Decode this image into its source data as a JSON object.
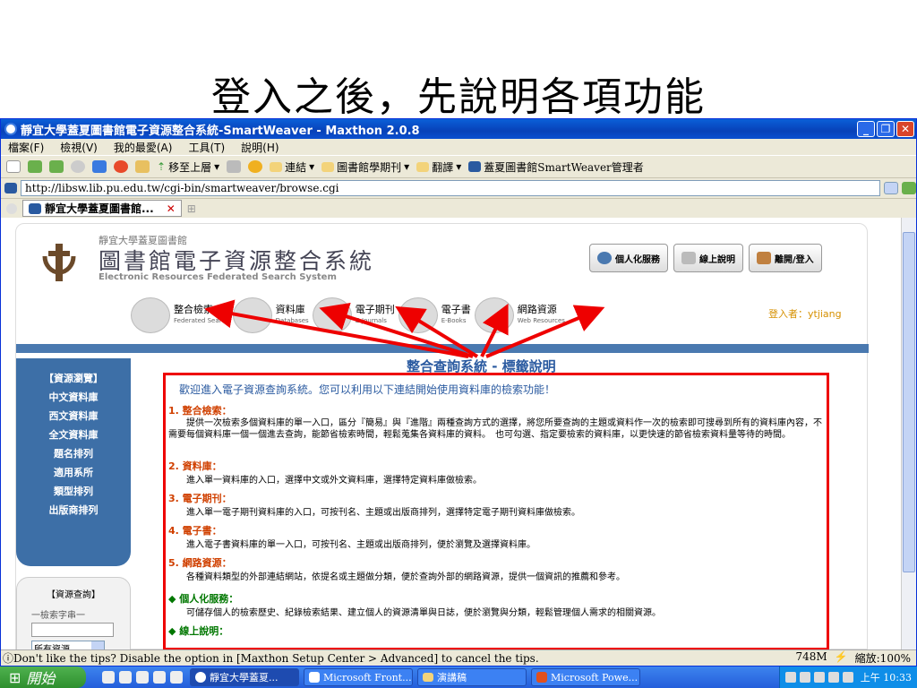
{
  "slide": {
    "title": "登入之後，先說明各項功能"
  },
  "window": {
    "title": "靜宜大學蓋夏圖書館電子資源整合系統-SmartWeaver - Maxthon 2.0.8"
  },
  "menu": [
    "檔案(F)",
    "檢視(V)",
    "我的最愛(A)",
    "工具(T)",
    "說明(H)"
  ],
  "toolbar": {
    "goup": "移至上層",
    "links": "連結",
    "journals": "圖書館學期刊",
    "translate": "翻譯",
    "admin": "蓋夏圖書館SmartWeaver管理者"
  },
  "address": {
    "url": "http://libsw.lib.pu.edu.tw/cgi-bin/smartweaver/browse.cgi"
  },
  "tab": {
    "label": "靜宜大學蓋夏圖書館..."
  },
  "page": {
    "lib_small": "靜宜大學蓋夏圖書館",
    "lib_big": "圖書館電子資源整合系統",
    "lib_en": "Electronic Resources Federated Search System",
    "buttons": [
      "個人化服務",
      "線上說明",
      "離開/登入"
    ],
    "nav": [
      {
        "zh": "整合檢索",
        "en": "Federated Search"
      },
      {
        "zh": "資料庫",
        "en": "Databases"
      },
      {
        "zh": "電子期刊",
        "en": "E-Journals"
      },
      {
        "zh": "電子書",
        "en": "E-Books"
      },
      {
        "zh": "網路資源",
        "en": "Web Resources"
      }
    ],
    "login": "登入者：ytjiang",
    "sidebar": [
      "【資源瀏覽】",
      "中文資料庫",
      "西文資料庫",
      "全文資料庫",
      "題名排列",
      "適用系所",
      "類型排列",
      "出版商排列"
    ],
    "search": {
      "title": "【資源查詢】",
      "label": "一檢索字串一",
      "select": "所有資源"
    },
    "content_title": "整合查詢系統 - 標籤說明",
    "welcome": "歡迎進入電子資源查詢系統。您可以利用以下連結開始使用資料庫的檢索功能！",
    "sections": [
      {
        "h": "1. 整合檢索：",
        "d": "提供一次檢索多個資料庫的單一入口，區分『簡易』與『進階』兩種查詢方式的選擇，將您所要查詢的主題或資料作一次的檢索即可搜尋到所有的資料庫內容，不需要每個資料庫一個一個進去查詢，能節省檢索時間，輕鬆蒐集各資料庫的資料。　也可勾選、指定要檢索的資料庫，以更快速的節省檢索資料量等待的時間。"
      },
      {
        "h": "2. 資料庫：",
        "d": "進入單一資料庫的入口，選擇中文或外文資料庫，選擇特定資料庫做檢索。"
      },
      {
        "h": "3. 電子期刊：",
        "d": "進入單一電子期刊資料庫的入口，可按刊名、主題或出版商排列，選擇特定電子期刊資料庫做檢索。"
      },
      {
        "h": "4. 電子書：",
        "d": "進入電子書資料庫的單一入口，可按刊名、主題或出版商排列，便於瀏覽及選擇資料庫。"
      },
      {
        "h": "5. 網路資源：",
        "d": "各種資料類型的外部連結網站，依提名或主題做分類，便於查詢外部的網路資源，提供一個資訊的推薦和參考。"
      },
      {
        "h": "◆ 個人化服務：",
        "d": "可儲存個人的檢索歷史、紀錄檢索結果、建立個人的資源清單與日誌，便於瀏覽與分類，輕鬆管理個人需求的相關資源。"
      },
      {
        "h": "◆ 線上說明：",
        "d": ""
      }
    ]
  },
  "status": {
    "tip": "Don't like the tips? Disable the option in [Maxthon Setup Center > Advanced] to cancel the tips.",
    "mem": "748M",
    "zoom": "縮放:100%"
  },
  "taskbar": {
    "start": "開始",
    "tasks": [
      "靜宜大學蓋夏...",
      "Microsoft Front...",
      "演講稿",
      "Microsoft Powe..."
    ],
    "time": "上午 10:33"
  }
}
